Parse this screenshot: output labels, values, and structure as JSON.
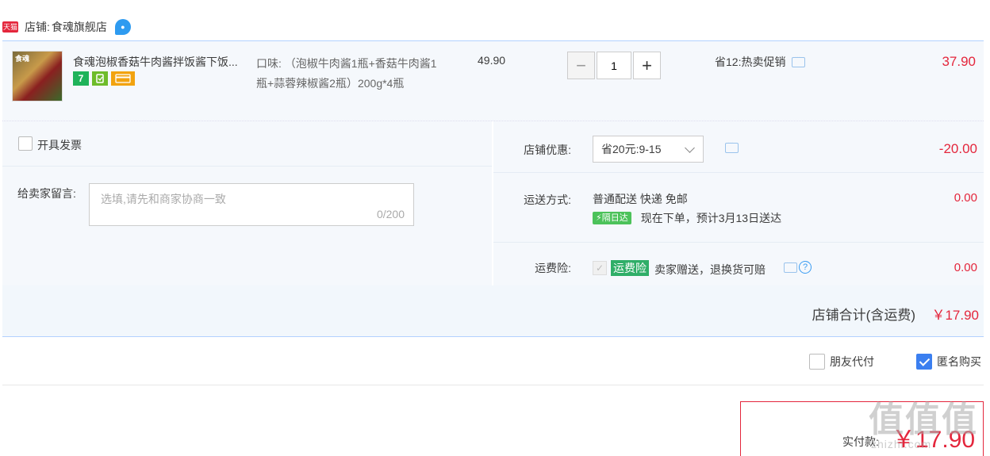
{
  "shop": {
    "badge": "天猫",
    "label": "店铺:",
    "name": "食魂旗舰店"
  },
  "item": {
    "thumb_label": "食魂",
    "title": "食魂泡椒香菇牛肉酱拌饭酱下饭...",
    "sku": "口味: （泡椒牛肉酱1瓶+香菇牛肉酱1瓶+蒜蓉辣椒酱2瓶）200g*4瓶",
    "unit_price": "49.90",
    "quantity": "1",
    "minus": "−",
    "plus": "+",
    "promo": "省12:热卖促销",
    "total": "37.90",
    "service_icons": [
      "seven-day-return-icon",
      "guarantee-icon",
      "credit-card-icon"
    ],
    "svc_7": "7",
    "svc_g": "",
    "svc_c": ""
  },
  "invoice": {
    "label": "开具发票"
  },
  "memo": {
    "label": "给卖家留言:",
    "placeholder": "选填,请先和商家协商一致",
    "count": "0/200"
  },
  "discount": {
    "label": "店铺优惠:",
    "selected": "省20元:9-15",
    "amount": "-20.00"
  },
  "shipping": {
    "label": "运送方式:",
    "method": "普通配送 快递 免邮",
    "badge": "隔日达",
    "eta": "现在下单，预计3月13日送达",
    "amount": "0.00"
  },
  "insurance": {
    "label": "运费险:",
    "check": "✓",
    "badge": "运费险",
    "text": "卖家赠送，退换货可赔",
    "help": "?",
    "amount": "0.00"
  },
  "subtotal": {
    "label": "店铺合计(含运费)",
    "value": "￥17.90"
  },
  "options": {
    "friend_pay": "朋友代付",
    "anonymous": "匿名购买"
  },
  "payment": {
    "label": "实付款:",
    "value": "￥17.90"
  },
  "watermark": {
    "main": "值值值",
    "sub": "zhizhi.com"
  },
  "colors": {
    "accent": "#e4263c",
    "border_blue": "#b2d1ff",
    "panel_bg": "#f5f8fc",
    "checkbox_blue": "#3b7ff0"
  }
}
